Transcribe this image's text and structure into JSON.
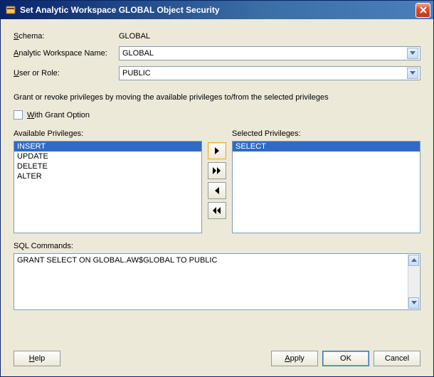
{
  "window": {
    "title": "Set Analytic Workspace GLOBAL Object Security"
  },
  "form": {
    "schema_label_pre": "S",
    "schema_label_post": "chema:",
    "schema_value": "GLOBAL",
    "aw_label_pre": "A",
    "aw_label_post": "nalytic Workspace Name:",
    "aw_value": "GLOBAL",
    "user_label_pre": "U",
    "user_label_post": "ser or Role:",
    "user_value": "PUBLIC"
  },
  "instruction": "Grant or revoke privileges by moving the available privileges to/from the selected privileges",
  "grant_option": {
    "label_pre": "W",
    "label_post": "ith Grant Option",
    "checked": false
  },
  "available": {
    "label": "Available Privileges:",
    "items": [
      "INSERT",
      "UPDATE",
      "DELETE",
      "ALTER"
    ],
    "selected_index": 0
  },
  "selected": {
    "label": "Selected Privileges:",
    "items": [
      "SELECT"
    ],
    "selected_index": 0
  },
  "sql": {
    "label": "SQL Commands:",
    "text": "GRANT SELECT ON GLOBAL.AW$GLOBAL TO PUBLIC"
  },
  "buttons": {
    "help_u": "H",
    "help_post": "elp",
    "apply_u": "A",
    "apply_post": "pply",
    "ok": "OK",
    "cancel": "Cancel"
  }
}
